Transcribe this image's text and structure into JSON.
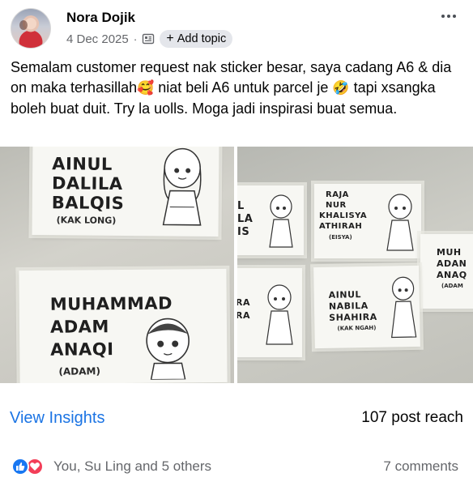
{
  "author": {
    "name": "Nora Dojik",
    "date": "4 Dec 2025",
    "separator": "·",
    "add_topic_label": "Add topic"
  },
  "post": {
    "text_part1": "Semalam customer request nak sticker besar, saya cadang A6 & dia on maka terhasillah",
    "emoji1": "🥰",
    "text_part2": " niat beli A6 untuk parcel je ",
    "emoji2": "🤣",
    "text_part3": " tapi xsangka boleh buat duit. Try la uolls. Moga jadi inspirasi buat semua."
  },
  "photos": {
    "left": {
      "card_top": {
        "line1": "AINUL",
        "line2": "DALILA",
        "line3": "BALQIS",
        "sub": "(KAK LONG)"
      },
      "card_bottom": {
        "line1": "MUHAMMAD",
        "line2": "ADAM",
        "line3": "ANAQI",
        "sub": "(ADAM)"
      }
    },
    "right": {
      "card_a": {
        "line1": "L",
        "line2": "LA",
        "line3": "IS"
      },
      "card_b": {
        "line1": "RAJA",
        "line2": "NUR",
        "line3": "KHALISYA",
        "line4": "ATHIRAH",
        "sub": "(EISYA)"
      },
      "card_c": {
        "line1": "MUH",
        "line2": "ADAN",
        "line3": "ANAQ",
        "sub": "(ADAM"
      },
      "card_d": {
        "line1": "RA",
        "line2": "RA"
      },
      "card_e": {
        "line1": "AINUL",
        "line2": "NABILA",
        "line3": "SHAHIRA",
        "sub": "(KAK NGAH)"
      }
    }
  },
  "insights": {
    "link_label": "View Insights",
    "reach": "107 post reach"
  },
  "reactions": {
    "names": "You, Su Ling and 5 others",
    "comments": "7 comments"
  },
  "colors": {
    "link_blue": "#1b74e4",
    "like_blue": "#1877f2",
    "love_red": "#f33e58",
    "muted_text": "#65676b"
  }
}
